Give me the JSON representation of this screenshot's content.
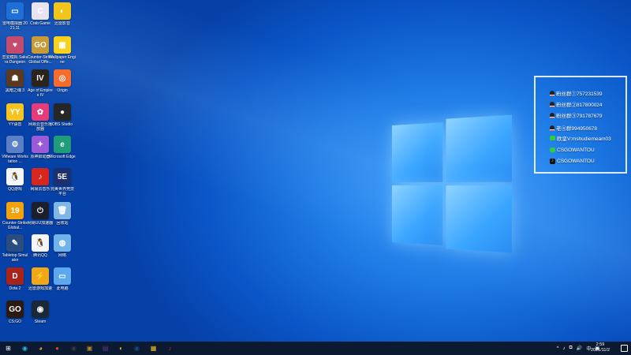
{
  "desktop_icons": [
    {
      "label": "雷电模拟器 2021.11",
      "icon": "monitor-icon",
      "color": "#1e6fd6",
      "glyph": "▭"
    },
    {
      "label": "Crab Game",
      "icon": "crab-game-icon",
      "color": "#e9e3ef",
      "glyph": "C"
    },
    {
      "label": "迅雷影音",
      "icon": "xunlei-icon",
      "color": "#f2c519",
      "glyph": "◐"
    },
    {
      "label": "恋爱模拟 Sakura Dungeon",
      "icon": "anime-game-icon",
      "color": "#c44a6e",
      "glyph": "♥"
    },
    {
      "label": "Counter-Strike Global Offe...",
      "icon": "csgo-icon",
      "color": "#c79a3a",
      "glyph": "GO"
    },
    {
      "label": "Wallpaper Engine",
      "icon": "wallpaper-engine-icon",
      "color": "#f7d21c",
      "glyph": "▦"
    },
    {
      "label": "黑暗之魂 3",
      "icon": "souls-game-icon",
      "color": "#5a3b22",
      "glyph": "☗"
    },
    {
      "label": "Age of Empires IV",
      "icon": "aoe4-icon",
      "color": "#2b241d",
      "glyph": "IV"
    },
    {
      "label": "Origin",
      "icon": "origin-icon",
      "color": "#f56c2d",
      "glyph": "◎"
    },
    {
      "label": "YY语音",
      "icon": "yy-icon",
      "color": "#f7c321",
      "glyph": "YY"
    },
    {
      "label": "网易云音乐播放器",
      "icon": "color-wheel-icon",
      "color": "#e63b7a",
      "glyph": "✿"
    },
    {
      "label": "OBS Studio",
      "icon": "obs-icon",
      "color": "#262626",
      "glyph": "●"
    },
    {
      "label": "VMware Workstation ...",
      "icon": "vmware-icon",
      "color": "#5b7fc7",
      "glyph": "⚙"
    },
    {
      "label": "原神启动器",
      "icon": "genshin-icon",
      "color": "#9a5bd9",
      "glyph": "✦"
    },
    {
      "label": "Microsoft Edge",
      "icon": "edge-icon",
      "color": "#1f9c7a",
      "glyph": "e"
    },
    {
      "label": "QQ游戏",
      "icon": "qq-game-icon",
      "color": "#f5f5f5",
      "glyph": "🐧"
    },
    {
      "label": "网易云音乐",
      "icon": "netease-music-icon",
      "color": "#d7261e",
      "glyph": "♪"
    },
    {
      "label": "完美世界竞技平台",
      "icon": "perfect-world-icon",
      "color": "#1c2f6e",
      "glyph": "5E"
    },
    {
      "label": "Counter-Strike Global...",
      "icon": "steam-shortcut-icon",
      "color": "#f1a20d",
      "glyph": "19"
    },
    {
      "label": "网易UU加速器",
      "icon": "uu-booster-icon",
      "color": "#1a1f2b",
      "glyph": "⏻"
    },
    {
      "label": "回收站",
      "icon": "recycle-bin-icon",
      "color": "#7fb6e6",
      "glyph": "🗑"
    },
    {
      "label": "Tabletop Simulator",
      "icon": "pen-icon",
      "color": "#2a4d80",
      "glyph": "✎"
    },
    {
      "label": "腾讯QQ",
      "icon": "qq-icon",
      "color": "#f5f5f5",
      "glyph": "🐧"
    },
    {
      "label": "网络",
      "icon": "network-icon",
      "color": "#6fb3ea",
      "glyph": "◍"
    },
    {
      "label": "Dota 2",
      "icon": "dota-icon",
      "color": "#a8231a",
      "glyph": "D"
    },
    {
      "label": "迅雷游戏加速",
      "icon": "lightning-icon",
      "color": "#f0a718",
      "glyph": "⚡"
    },
    {
      "label": "此电脑",
      "icon": "computer-icon",
      "color": "#5ba8ee",
      "glyph": "▭"
    },
    {
      "label": "CS:GO",
      "icon": "csgo-fan-icon",
      "color": "#2a1a12",
      "glyph": "GO"
    },
    {
      "label": "Steam",
      "icon": "steam-icon",
      "color": "#1b2838",
      "glyph": "◉"
    }
  ],
  "fan_panel": {
    "rows": [
      {
        "icon": "qq-penguin-icon",
        "text": "粉丝群①757231539"
      },
      {
        "icon": "qq-penguin-icon",
        "text": "粉丝群②817800024"
      },
      {
        "icon": "qq-penguin-icon",
        "text": "粉丝群③791787679"
      },
      {
        "icon": "qq-penguin-icon",
        "text": "老④群994950678"
      },
      {
        "icon": "wechat-icon",
        "text": "欧皇V:mshudiemeam03"
      },
      {
        "icon": "wechat-icon",
        "text": "CSGOWANTOU"
      },
      {
        "icon": "tiktok-icon",
        "text": "CSGOWANTOU"
      }
    ]
  },
  "taskbar": {
    "items": [
      {
        "icon": "windows-start-icon",
        "color": "#ffffff",
        "glyph": "⊞"
      },
      {
        "icon": "chrome-edge-icon",
        "color": "#2fb2d9",
        "glyph": "◉"
      },
      {
        "icon": "chrome-icon",
        "color": "#e8a23a",
        "glyph": "◕"
      },
      {
        "icon": "red-app-icon",
        "color": "#d9402b",
        "glyph": "●"
      },
      {
        "icon": "obs-icon",
        "color": "#3a3a3a",
        "glyph": "◉"
      },
      {
        "icon": "photo-icon",
        "color": "#b8892c",
        "glyph": "▣"
      },
      {
        "icon": "purple-app-icon",
        "color": "#5e3a8c",
        "glyph": "▤"
      },
      {
        "icon": "xunlei-icon",
        "color": "#e8c21e",
        "glyph": "◐"
      },
      {
        "icon": "steam-icon",
        "color": "#1b4a7a",
        "glyph": "◉"
      },
      {
        "icon": "gallery-icon",
        "color": "#f2c21c",
        "glyph": "▦"
      },
      {
        "icon": "netease-icon",
        "color": "#d7261e",
        "glyph": "♪"
      }
    ],
    "tray_glyphs": [
      "^",
      "♪",
      "⧉",
      "🔊",
      "中",
      "▣"
    ],
    "time": "2:59",
    "date": "2021/11/2"
  }
}
